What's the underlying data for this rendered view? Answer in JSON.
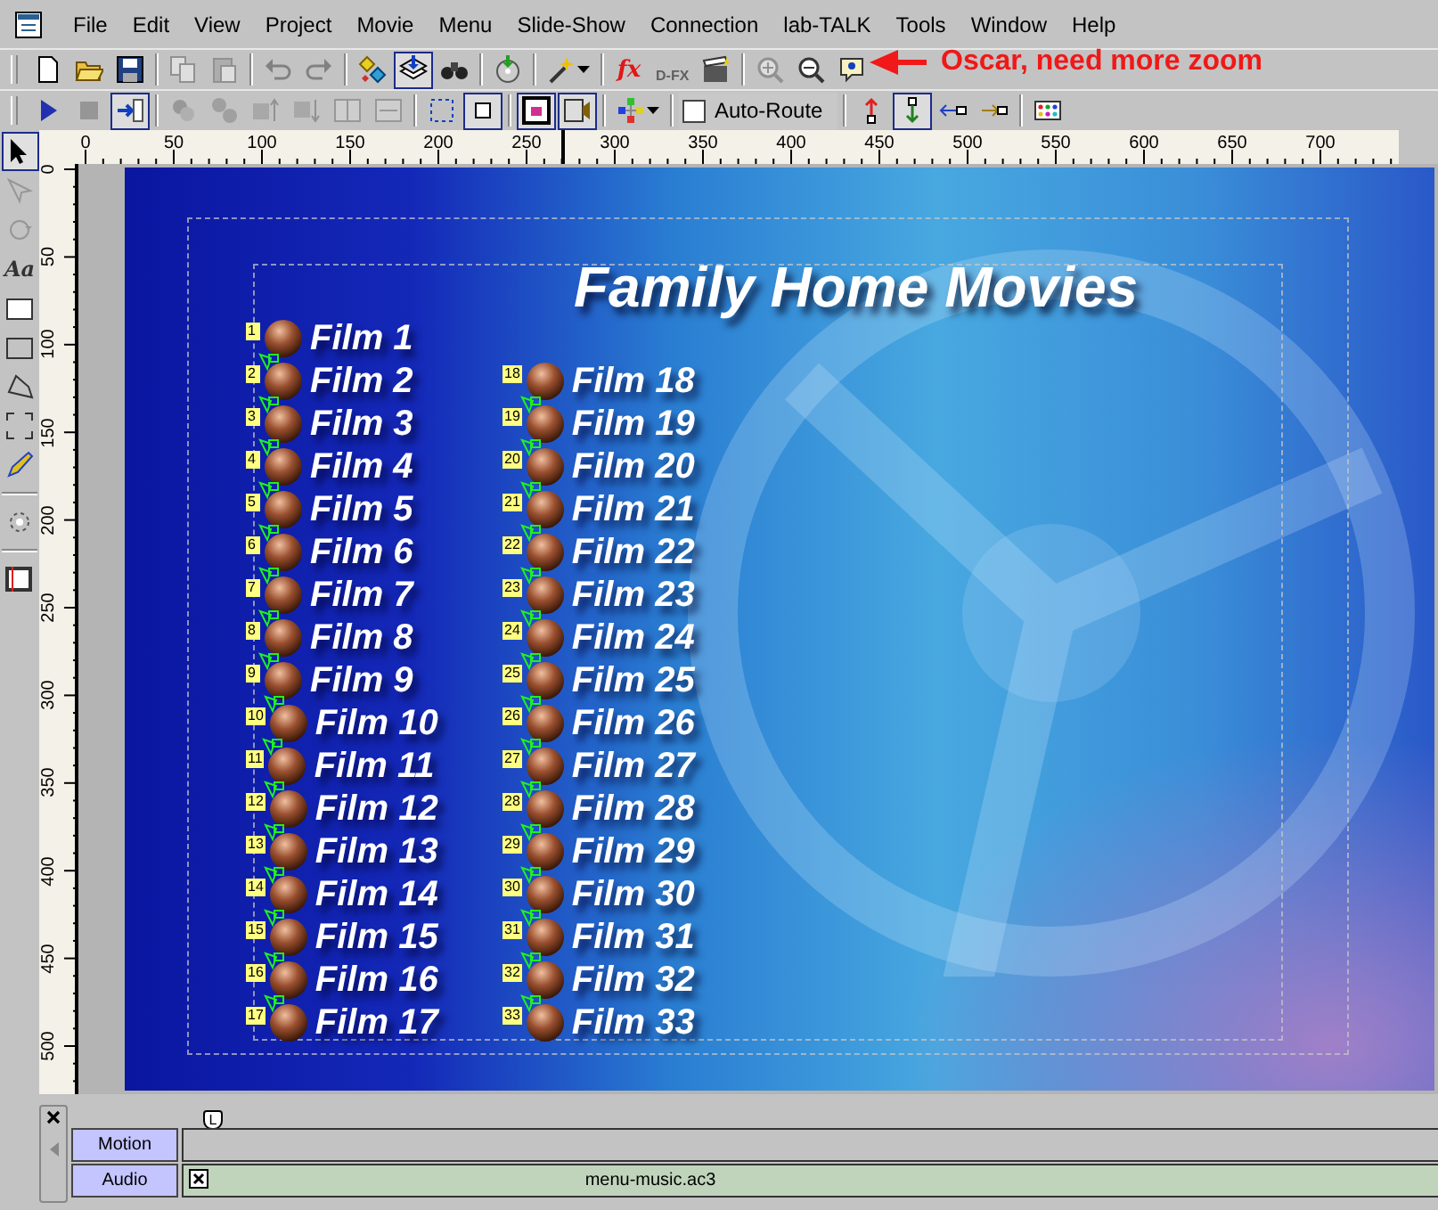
{
  "menu_bar": [
    "File",
    "Edit",
    "View",
    "Project",
    "Movie",
    "Menu",
    "Slide-Show",
    "Connection",
    "lab-TALK",
    "Tools",
    "Window",
    "Help"
  ],
  "toolbar_1": [
    [
      {
        "kind": "button",
        "pressed": false,
        "disabled": false
      },
      {
        "kind": "button",
        "pressed": false,
        "disabled": false
      },
      {
        "kind": "button",
        "pressed": false,
        "disabled": false
      }
    ],
    [
      {
        "kind": "button",
        "pressed": false,
        "disabled": true
      },
      {
        "kind": "button",
        "pressed": false,
        "disabled": true
      }
    ],
    [
      {
        "kind": "button",
        "pressed": false,
        "disabled": true
      },
      {
        "kind": "button",
        "pressed": false,
        "disabled": true
      }
    ],
    [
      {
        "kind": "button",
        "pressed": false,
        "disabled": false
      },
      {
        "kind": "button",
        "pressed": true,
        "disabled": false
      },
      {
        "kind": "button",
        "pressed": false,
        "disabled": false
      }
    ],
    [
      {
        "kind": "button",
        "pressed": false,
        "disabled": false
      }
    ],
    [
      {
        "kind": "button",
        "pressed": false,
        "disabled": false
      }
    ],
    [
      {
        "kind": "button",
        "pressed": false,
        "disabled": false,
        "label": "fx"
      },
      {
        "kind": "button",
        "pressed": false,
        "disabled": true,
        "label": "D-FX"
      },
      {
        "kind": "button",
        "pressed": false,
        "disabled": false
      }
    ],
    [
      {
        "kind": "button",
        "pressed": false,
        "disabled": true
      },
      {
        "kind": "button",
        "pressed": false,
        "disabled": false
      },
      {
        "kind": "button",
        "pressed": false,
        "disabled": false
      }
    ]
  ],
  "annotation": {
    "text": "Oscar, need more zoom"
  },
  "toolbar_2": [
    [
      {
        "kind": "button",
        "pressed": false,
        "disabled": false
      },
      {
        "kind": "button",
        "pressed": false,
        "disabled": true
      },
      {
        "kind": "button",
        "pressed": true,
        "disabled": false
      }
    ],
    [
      {
        "kind": "button",
        "pressed": false,
        "disabled": true
      },
      {
        "kind": "button",
        "pressed": false,
        "disabled": true
      },
      {
        "kind": "button",
        "pressed": false,
        "disabled": true
      },
      {
        "kind": "button",
        "pressed": false,
        "disabled": true
      },
      {
        "kind": "button",
        "pressed": false,
        "disabled": true
      },
      {
        "kind": "button",
        "pressed": false,
        "disabled": true
      }
    ],
    [
      {
        "kind": "button",
        "pressed": false,
        "disabled": false
      },
      {
        "kind": "button",
        "pressed": true,
        "disabled": false
      }
    ],
    [
      {
        "kind": "button",
        "pressed": true,
        "disabled": false
      },
      {
        "kind": "button",
        "pressed": true,
        "disabled": false
      }
    ],
    [
      {
        "kind": "button",
        "pressed": false,
        "disabled": false
      }
    ],
    [
      {
        "kind": "checkbox",
        "label": "Auto-Route",
        "checked": false
      }
    ],
    [
      {
        "kind": "button",
        "pressed": false,
        "disabled": false
      },
      {
        "kind": "button",
        "pressed": true,
        "disabled": false
      },
      {
        "kind": "button",
        "pressed": false,
        "disabled": false
      },
      {
        "kind": "button",
        "pressed": false,
        "disabled": false
      }
    ],
    [
      {
        "kind": "button",
        "pressed": false,
        "disabled": false
      }
    ]
  ],
  "tools": [
    [
      {
        "selected": true,
        "disabled": false
      },
      {
        "selected": false,
        "disabled": true
      },
      {
        "selected": false,
        "disabled": true
      },
      {
        "selected": false,
        "disabled": false,
        "label": "Aa"
      },
      {
        "selected": false,
        "disabled": false
      },
      {
        "selected": false,
        "disabled": false
      },
      {
        "selected": false,
        "disabled": false
      },
      {
        "selected": false,
        "disabled": false
      },
      {
        "selected": false,
        "disabled": false
      }
    ],
    [
      {
        "selected": false,
        "disabled": false
      }
    ],
    [
      {
        "selected": false,
        "disabled": false
      }
    ]
  ],
  "horizontal_ruler": {
    "labels": [
      "0",
      "50",
      "100",
      "150",
      "200",
      "250",
      "300",
      "350",
      "400",
      "450",
      "500",
      "550",
      "600",
      "650",
      "700"
    ]
  },
  "vertical_ruler": {
    "labels": [
      "0",
      "50",
      "100",
      "150",
      "200",
      "250",
      "300",
      "350",
      "400",
      "450",
      "500"
    ]
  },
  "menu_canvas": {
    "title": "Family Home Movies",
    "columns": [
      [
        {
          "label": "Film 1",
          "badge": "1",
          "linked": false
        },
        {
          "label": "Film 2",
          "badge": "2",
          "linked": true
        },
        {
          "label": "Film 3",
          "badge": "3",
          "linked": true
        },
        {
          "label": "Film 4",
          "badge": "4",
          "linked": true
        },
        {
          "label": "Film 5",
          "badge": "5",
          "linked": true
        },
        {
          "label": "Film 6",
          "badge": "6",
          "linked": true
        },
        {
          "label": "Film 7",
          "badge": "7",
          "linked": true
        },
        {
          "label": "Film 8",
          "badge": "8",
          "linked": true
        },
        {
          "label": "Film 9",
          "badge": "9",
          "linked": true
        },
        {
          "label": "Film 10",
          "badge": "10",
          "linked": true
        },
        {
          "label": "Film 11",
          "badge": "11",
          "linked": true
        },
        {
          "label": "Film 12",
          "badge": "12",
          "linked": true
        },
        {
          "label": "Film 13",
          "badge": "13",
          "linked": true
        },
        {
          "label": "Film 14",
          "badge": "14",
          "linked": true
        },
        {
          "label": "Film 15",
          "badge": "15",
          "linked": true
        },
        {
          "label": "Film 16",
          "badge": "16",
          "linked": true
        },
        {
          "label": "Film 17",
          "badge": "17",
          "linked": true
        }
      ],
      [
        {
          "label": "Film 18",
          "badge": "18",
          "linked": false
        },
        {
          "label": "Film 19",
          "badge": "19",
          "linked": true
        },
        {
          "label": "Film 20",
          "badge": "20",
          "linked": true
        },
        {
          "label": "Film 21",
          "badge": "21",
          "linked": true
        },
        {
          "label": "Film 22",
          "badge": "22",
          "linked": true
        },
        {
          "label": "Film 23",
          "badge": "23",
          "linked": true
        },
        {
          "label": "Film 24",
          "badge": "24",
          "linked": true
        },
        {
          "label": "Film 25",
          "badge": "25",
          "linked": true
        },
        {
          "label": "Film 26",
          "badge": "26",
          "linked": true
        },
        {
          "label": "Film 27",
          "badge": "27",
          "linked": true
        },
        {
          "label": "Film 28",
          "badge": "28",
          "linked": true
        },
        {
          "label": "Film 29",
          "badge": "29",
          "linked": true
        },
        {
          "label": "Film 30",
          "badge": "30",
          "linked": true
        },
        {
          "label": "Film 31",
          "badge": "31",
          "linked": true
        },
        {
          "label": "Film 32",
          "badge": "32",
          "linked": true
        },
        {
          "label": "Film 33",
          "badge": "33",
          "linked": true
        }
      ]
    ]
  },
  "timeline": {
    "marker": "L",
    "tracks": [
      {
        "label": "Motion"
      },
      {
        "label": "Audio",
        "clip": {
          "label": "menu-music.ac3"
        }
      }
    ]
  }
}
